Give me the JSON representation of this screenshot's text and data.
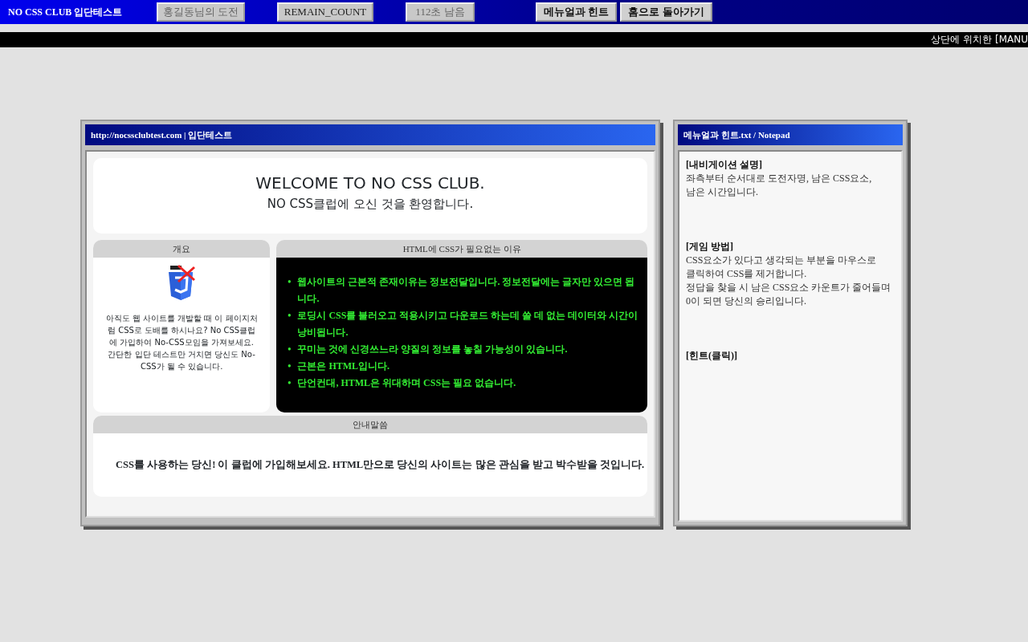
{
  "top_bar": {
    "title": "NO CSS CLUB 입단테스트",
    "status_fields": [
      {
        "text": "홍길동님의 도전",
        "disabled": true
      },
      {
        "text": "REMAIN_COUNT",
        "disabled": false
      },
      {
        "text": "112초 남음",
        "disabled": true
      }
    ],
    "buttons": [
      "메뉴얼과 힌트",
      "홈으로 돌아가기"
    ]
  },
  "ticker": "상단에 위치한 [MANU",
  "main_window": {
    "title": "http://nocssclubtest.com | 입단테스트",
    "welcome": {
      "heading": "WELCOME TO NO CSS CLUB.",
      "subheading": "NO CSS클럽에 오신 것을 환영합니다."
    },
    "overview": {
      "title": "개요",
      "text": "아직도 웹 사이트를 개발할 때 이 페이지처럼 CSS로 도배를 하시나요? No CSS클럽에 가입하여 No-CSS모임을 가져보세요. 간단한 입단 테스트만 거치면 당신도 No-CSS가 될 수 있습니다."
    },
    "reasons": {
      "title": "HTML에 CSS가 필요없는 이유",
      "items": [
        {
          "marker": "•",
          "text": "웹사이트의 근본적 존재이유는 정보전달입니다. 정보전달에는 글자만 있으면 됩니다."
        },
        {
          "marker": "•",
          "text": "로딩시 CSS를 불러오고 적용시키고 다운로드 하는데 쓸 데 없는 데이터와 시간이 낭비됩니다."
        },
        {
          "marker": "•",
          "text": "꾸미는 것에 신경쓰느라 양질의 정보를 놓칠 가능성이 있습니다."
        },
        {
          "marker": "•",
          "text": "근본은 HTML입니다."
        },
        {
          "marker": "•",
          "text": "단언컨대, HTML은 위대하며 CSS는 필요 없습니다."
        }
      ]
    },
    "notice": {
      "title": "안내말씀",
      "text": "CSS를 사용하는 당신! 이 클럽에 가입해보세요. HTML만으로 당신의 사이트는 많은 관심을 받고 박수받을 것입니다."
    }
  },
  "notepad": {
    "title": "메뉴얼과 힌트.txt / Notepad",
    "sections": [
      {
        "heading": "[내비게이션 설명]",
        "lines": [
          "좌측부터 순서대로 도전자명, 남은 CSS요소,",
          "남은 시간입니다."
        ]
      },
      {
        "heading": "[게임 방법]",
        "lines": [
          "CSS요소가 있다고 생각되는 부분을 마우스로",
          "클릭하여 CSS를 제거합니다.",
          "정답을 찾을 시 남은 CSS요소 카운트가 줄어들며",
          "0이 되면 당신의 승리입니다."
        ]
      },
      {
        "heading": "[힌트(클릭)]"
      }
    ]
  }
}
